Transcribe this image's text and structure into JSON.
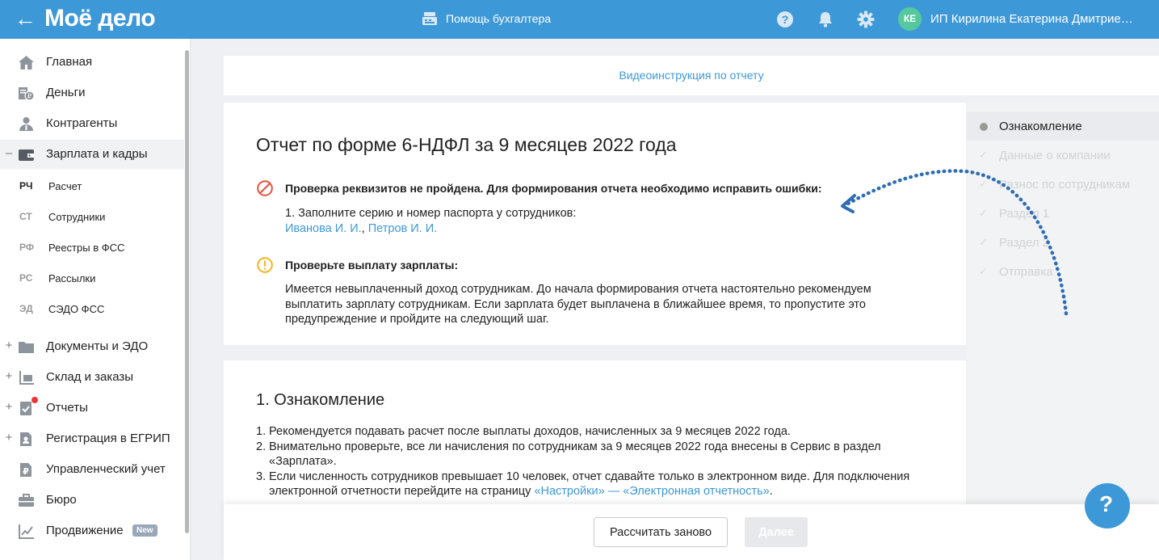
{
  "topbar": {
    "logo": "Моё дело",
    "helper": "Помощь бухгалтера",
    "user_initials": "КЕ",
    "user_name": "ИП Кирилина Екатерина Дмитрие…",
    "bg_color": "#3d98d8"
  },
  "sidebar": {
    "items": [
      {
        "label": "Главная",
        "icon": "home-icon"
      },
      {
        "label": "Деньги",
        "icon": "money-icon"
      },
      {
        "label": "Контрагенты",
        "icon": "contractors-icon"
      },
      {
        "label": "Зарплата и кадры",
        "icon": "wallet-icon",
        "expanded": true,
        "toggle": "–"
      },
      {
        "label": "Документы и ЭДО",
        "icon": "folder-icon",
        "toggle": "+"
      },
      {
        "label": "Склад и заказы",
        "icon": "warehouse-icon",
        "toggle": "+"
      },
      {
        "label": "Отчеты",
        "icon": "reports-icon",
        "toggle": "+"
      },
      {
        "label": "Регистрация в ЕГРИП",
        "icon": "registration-icon",
        "toggle": "+"
      },
      {
        "label": "Управленческий учет",
        "icon": "ruble-doc-icon"
      },
      {
        "label": "Бюро",
        "icon": "briefcase-icon"
      },
      {
        "label": "Продвижение",
        "icon": "chart-icon",
        "badge": "New"
      }
    ],
    "subitems": [
      {
        "abbr": "РЧ",
        "label": "Расчет",
        "active": true
      },
      {
        "abbr": "СТ",
        "label": "Сотрудники"
      },
      {
        "abbr": "РФ",
        "label": "Реестры в ФСС"
      },
      {
        "abbr": "РС",
        "label": "Рассылки"
      },
      {
        "abbr": "ЭД",
        "label": "СЭДО ФСС"
      }
    ]
  },
  "video_link": "Видеоинструкция по отчету",
  "report": {
    "title": "Отчет по форме 6-НДФЛ за 9 месяцев 2022 года",
    "error": {
      "title": "Проверка реквизитов не пройдена. Для формирования отчета необходимо исправить ошибки:",
      "item": "1. Заполните серию и номер паспорта у сотрудников:",
      "employee_1": "Иванова И. И.",
      "separator": ", ",
      "employee_2": "Петров И. И."
    },
    "warning": {
      "title": "Проверьте выплату зарплаты:",
      "line1": "Имеется невыплаченный доход сотрудникам. До начала формирования отчета настоятельно рекомендуем",
      "line2": "выплатить зарплату сотрудникам. Если зарплата будет выплачена в ближайшее время, то пропустите это",
      "line3": "предупреждение и пройдите на следующий шаг."
    }
  },
  "intro": {
    "title": "1. Ознакомление",
    "items": [
      {
        "num": "1.",
        "text": "Рекомендуется подавать расчет после выплаты доходов, начисленных за 9 месяцев 2022 года."
      },
      {
        "num": "2.",
        "text": "Внимательно проверьте, все ли начисления по сотрудникам за 9 месяцев 2022 года внесены в Сервис в раздел «Зарплата»."
      },
      {
        "num": "3.",
        "text": "Если численность сотрудников превышает 10 человек, отчет сдавайте только в электронном виде. Для подключения электронной отчетности перейдите на страницу ",
        "link": "«Настройки» — «Электронная отчетность»",
        "tail": "."
      }
    ]
  },
  "steps": [
    {
      "label": "Ознакомление",
      "current": true
    },
    {
      "label": "Данные о компании"
    },
    {
      "label": "Разнос по сотрудникам"
    },
    {
      "label": "Раздел 1"
    },
    {
      "label": "Раздел 2"
    },
    {
      "label": "Отправка"
    }
  ],
  "footer": {
    "recalc": "Рассчитать заново",
    "next": "Далее"
  }
}
